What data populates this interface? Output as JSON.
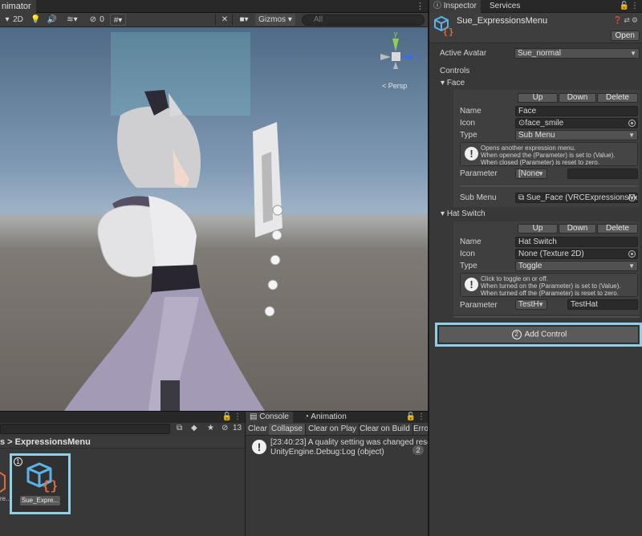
{
  "scene": {
    "tab_label": "nimator",
    "mode_2d": "2D",
    "hidden_count": "0",
    "gizmos_label": "Gizmos",
    "search_placeholder": "All",
    "persp_label": "< Persp",
    "axis_y": "y",
    "axis_z": "z"
  },
  "project": {
    "hidden_count": "13",
    "breadcrumb": "s > ExpressionsMenu",
    "asset_label": "Sue_Expre...",
    "asset_label_partial": "re...",
    "badge": "1"
  },
  "console": {
    "tabs": [
      "Console",
      "Animation"
    ],
    "toolbar": [
      "Clear",
      "Collapse",
      "Clear on Play",
      "Clear on Build",
      "Erro"
    ],
    "log_line1": "[23:40:23] A quality setting was changed rese",
    "log_line2": "UnityEngine.Debug:Log (object)",
    "log_count": "2"
  },
  "inspector": {
    "tabs": [
      "Inspector",
      "Services"
    ],
    "title": "Sue_ExpressionsMenu",
    "open_label": "Open",
    "active_avatar_label": "Active Avatar",
    "active_avatar_value": "Sue_normal",
    "controls_label": "Controls",
    "buttons": {
      "up": "Up",
      "down": "Down",
      "delete": "Delete"
    },
    "field_labels": {
      "name": "Name",
      "icon": "Icon",
      "type": "Type",
      "parameter": "Parameter",
      "sub_menu": "Sub Menu"
    },
    "face": {
      "foldout": "Face",
      "name": "Face",
      "icon": "face_smile",
      "type": "Sub Menu",
      "help": [
        "Opens another expression menu.",
        "When opened the (Parameter) is set to (Value).",
        "When closed (Parameter) is reset to zero."
      ],
      "parameter": "[None",
      "sub_menu": "Sue_Face (VRCExpressionsMe"
    },
    "hat": {
      "foldout": "Hat Switch",
      "name": "Hat Switch",
      "icon": "None (Texture 2D)",
      "type": "Toggle",
      "help": [
        "Click to toggle on or off.",
        "When turned on the (Parameter) is set to (Value).",
        "When turned off the (Parameter) is reset to zero."
      ],
      "parameter": "TestH",
      "parameter_value": "TestHat"
    },
    "add_control_badge": "2",
    "add_control_label": "Add Control"
  },
  "colors": {
    "highlight": "#8fd0e6",
    "panel": "#383838",
    "field": "#2a2a2a"
  }
}
